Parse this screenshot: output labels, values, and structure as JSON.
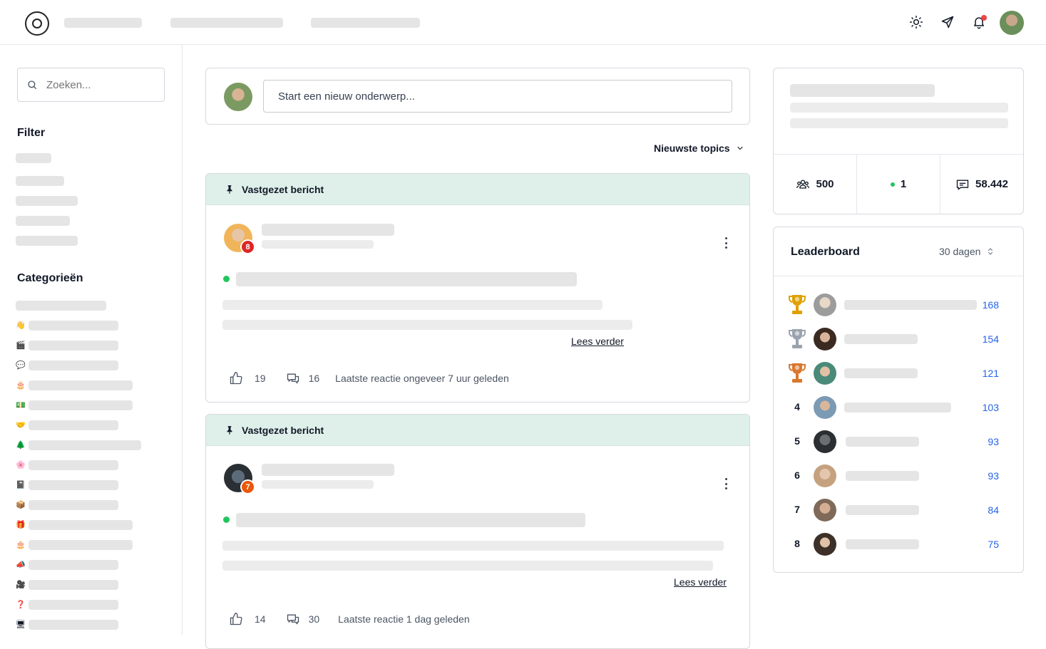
{
  "header": {
    "icons": [
      "sun-icon",
      "send-icon",
      "bell-icon"
    ]
  },
  "sidebar": {
    "search_placeholder": "Zoeken...",
    "filter_heading": "Filter",
    "categories_heading": "Categorieën",
    "category_emojis": [
      "👋",
      "🎬",
      "💬",
      "🎂",
      "💵",
      "🤝",
      "🌲",
      "🌸",
      "📓",
      "📦",
      "🎁",
      "🎂",
      "📣",
      "🎥",
      "❓",
      "🖥"
    ]
  },
  "composer": {
    "placeholder": "Start een nieuw onderwerp..."
  },
  "sort": {
    "label": "Nieuwste topics"
  },
  "posts": [
    {
      "pinned_label": "Vastgezet bericht",
      "level": "8",
      "read_more": "Lees verder",
      "likes": "19",
      "comments": "16",
      "last_reply": "Laatste reactie ongeveer 7 uur geleden"
    },
    {
      "pinned_label": "Vastgezet bericht",
      "level": "7",
      "read_more": "Lees verder",
      "likes": "14",
      "comments": "30",
      "last_reply": "Laatste reactie 1 dag geleden"
    }
  ],
  "stats": {
    "members": "500",
    "online": "1",
    "posts": "58.442"
  },
  "leaderboard": {
    "title": "Leaderboard",
    "period": "30 dagen",
    "rows": [
      {
        "rank": "1",
        "score": "168"
      },
      {
        "rank": "2",
        "score": "154"
      },
      {
        "rank": "3",
        "score": "121"
      },
      {
        "rank": "4",
        "score": "103"
      },
      {
        "rank": "5",
        "score": "93"
      },
      {
        "rank": "6",
        "score": "93"
      },
      {
        "rank": "7",
        "score": "84"
      },
      {
        "rank": "8",
        "score": "75"
      }
    ]
  },
  "colors": {
    "accent_blue": "#2563eb",
    "pinned_bg": "#dff0ea",
    "online_green": "#22c55e",
    "badge_red": "#dc2626",
    "badge_orange": "#ea580c"
  }
}
